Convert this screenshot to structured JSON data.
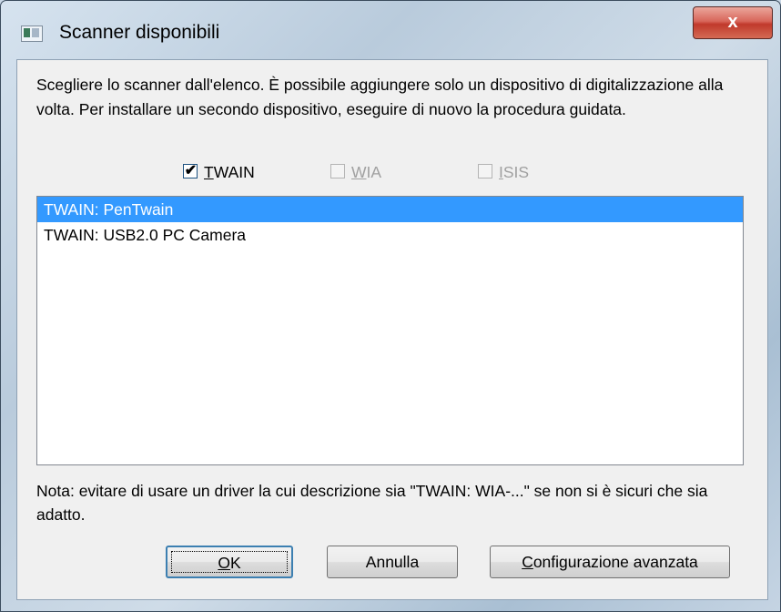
{
  "window": {
    "title": "Scanner disponibili",
    "close_label": "x"
  },
  "instructions": "Scegliere lo scanner dall'elenco. È possibile aggiungere solo un dispositivo di digitalizzazione alla volta. Per installare un secondo dispositivo, eseguire di nuovo la procedura guidata.",
  "filters": [
    {
      "label_first": "T",
      "label_rest": "WAIN",
      "checked": true,
      "enabled": true,
      "mark": "✔"
    },
    {
      "label_first": "W",
      "label_rest": "IA",
      "checked": false,
      "enabled": false,
      "mark": ""
    },
    {
      "label_first": "I",
      "label_rest": "SIS",
      "checked": false,
      "enabled": false,
      "mark": ""
    }
  ],
  "devices": [
    {
      "label": "TWAIN: PenTwain",
      "selected": true
    },
    {
      "label": "TWAIN: USB2.0 PC Camera",
      "selected": false
    }
  ],
  "note": "Nota: evitare di usare un driver la cui descrizione sia \"TWAIN: WIA-...\" se non si è sicuri che sia adatto.",
  "buttons": {
    "ok_first": "O",
    "ok_rest": "K",
    "cancel": "Annulla",
    "advanced_first": "C",
    "advanced_rest": "onfigurazione avanzata"
  },
  "colors": {
    "selection": "#3399ff",
    "close_button": "#c0392b",
    "disabled_text": "#a0a0a0"
  }
}
